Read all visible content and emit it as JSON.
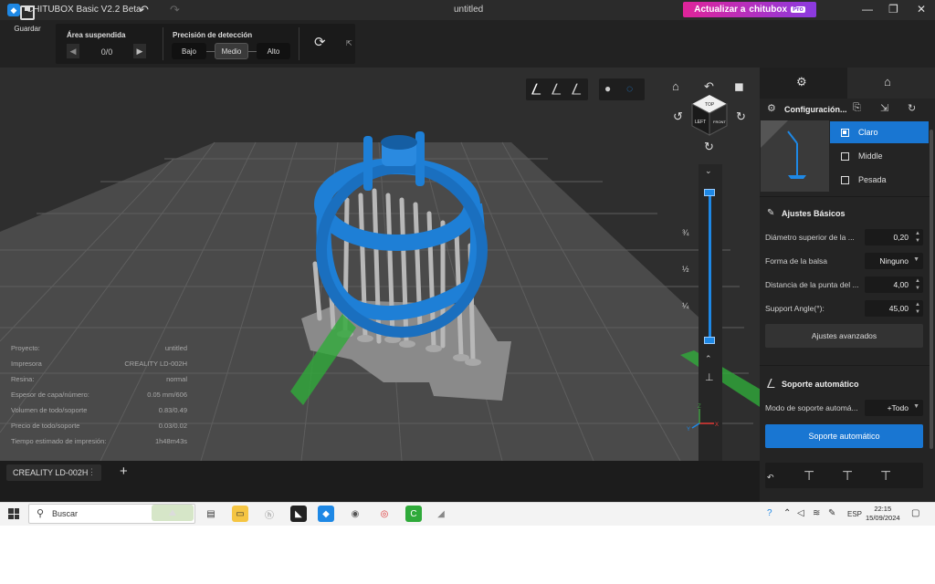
{
  "titlebar": {
    "app_title": "CHITUBOX Basic V2.2 Beta",
    "document": "untitled",
    "upgrade_label": "Actualizar a",
    "upgrade_brand": "chitubox",
    "upgrade_badge": "Pro"
  },
  "toolbar": {
    "save_label": "Guardar",
    "overhang": {
      "title": "Área suspendida",
      "value": "0/0"
    },
    "precision": {
      "title": "Precisión de detección",
      "options": [
        "Bajo",
        "Medio",
        "Alto"
      ],
      "selected": "Medio"
    }
  },
  "viewport": {
    "cube_labels": {
      "top": "TOP",
      "left": "LEFT",
      "front": "FRONT"
    },
    "slider_ticks": [
      "¾",
      "½",
      "¼"
    ],
    "info": [
      {
        "label": "Proyecto:",
        "value": "untitled"
      },
      {
        "label": "Impresora",
        "value": "CREALITY LD-002H"
      },
      {
        "label": "Resina:",
        "value": "normal"
      },
      {
        "label": "Espesor de capa/número:",
        "value": "0.05 mm/606"
      },
      {
        "label": "Volumen de todo/soporte",
        "value": "0.83/0.49"
      },
      {
        "label": "Precio de todo/soporte",
        "value": "0.03/0.02"
      },
      {
        "label": "Tiempo estimado de impresión:",
        "value": "1h48m43s"
      }
    ],
    "axis_labels": {
      "x": "X",
      "y": "Y",
      "z": "Z"
    }
  },
  "tabs": {
    "printer": "CREALITY LD-002H"
  },
  "right_panel": {
    "config_label": "Configuración...",
    "presets": [
      {
        "label": "Claro",
        "selected": true
      },
      {
        "label": "Middle",
        "selected": false
      },
      {
        "label": "Pesada",
        "selected": false
      }
    ],
    "basic_title": "Ajustes Básicos",
    "params": [
      {
        "label": "Diámetro superior de la ...",
        "value": "0,20",
        "kind": "spin"
      },
      {
        "label": "Forma de la balsa",
        "value": "Ninguno",
        "kind": "dropdown"
      },
      {
        "label": "Distancia de la punta del ...",
        "value": "4,00",
        "kind": "spin"
      },
      {
        "label": "Support Angle(°):",
        "value": "45,00",
        "kind": "spin"
      }
    ],
    "advanced_button": "Ajustes avanzados",
    "auto_title": "Soporte automático",
    "auto_mode_label": "Modo de soporte automá...",
    "auto_mode_value": "+Todo",
    "auto_button": "Soporte automático"
  },
  "taskbar": {
    "search_placeholder": "Buscar",
    "lang": "ESP",
    "time": "22:15",
    "date": "15/09/2024"
  },
  "colors": {
    "accent": "#1976d2",
    "model": "#1e7fd6",
    "supports": "#b8b8b8",
    "upgrade_from": "#e0249a",
    "upgrade_to": "#8a3be0"
  }
}
